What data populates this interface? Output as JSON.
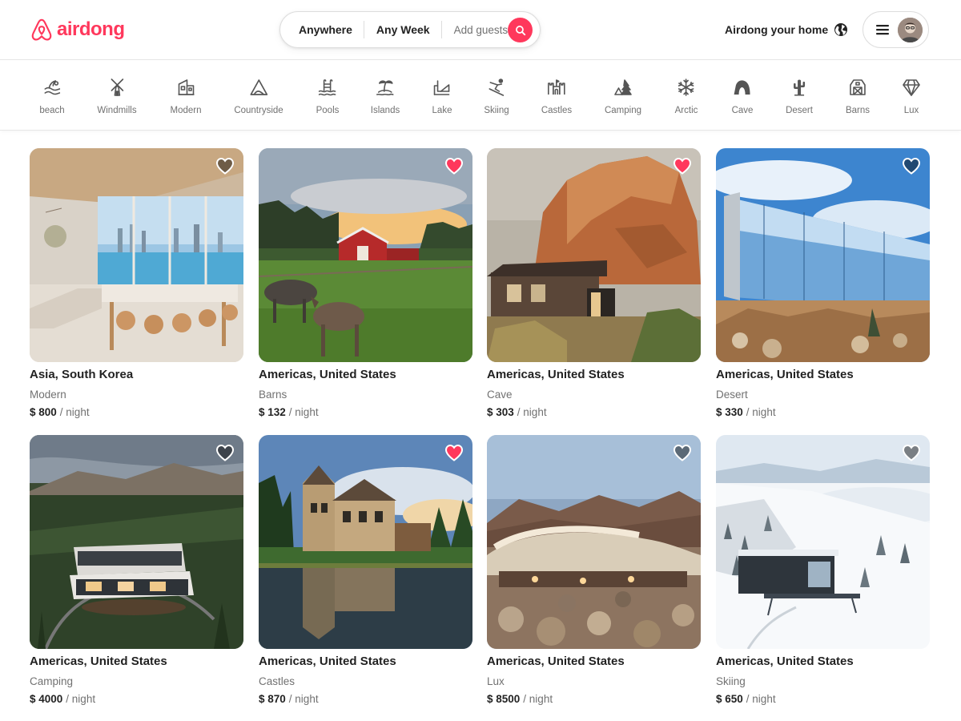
{
  "brand": {
    "name": "airdong",
    "color": "#ff385c"
  },
  "search": {
    "where": "Anywhere",
    "when": "Any Week",
    "who": "Add guests",
    "button_icon": "search-icon"
  },
  "header": {
    "host_link": "Airdong your home",
    "globe_icon": "globe-icon",
    "menu_icon": "hamburger-icon"
  },
  "categories": [
    {
      "label": "beach",
      "icon": "beach-icon"
    },
    {
      "label": "Windmills",
      "icon": "windmill-icon"
    },
    {
      "label": "Modern",
      "icon": "modern-house-icon"
    },
    {
      "label": "Countryside",
      "icon": "countryside-icon"
    },
    {
      "label": "Pools",
      "icon": "pool-icon"
    },
    {
      "label": "Islands",
      "icon": "island-icon"
    },
    {
      "label": "Lake",
      "icon": "lake-icon"
    },
    {
      "label": "Skiing",
      "icon": "skiing-icon"
    },
    {
      "label": "Castles",
      "icon": "castle-icon"
    },
    {
      "label": "Camping",
      "icon": "camping-icon"
    },
    {
      "label": "Arctic",
      "icon": "snowflake-icon"
    },
    {
      "label": "Cave",
      "icon": "cave-icon"
    },
    {
      "label": "Desert",
      "icon": "cactus-icon"
    },
    {
      "label": "Barns",
      "icon": "barn-icon"
    },
    {
      "label": "Lux",
      "icon": "diamond-icon"
    }
  ],
  "listings": [
    {
      "location": "Asia, South Korea",
      "category": "Modern",
      "price": "$ 800",
      "per": "/ night",
      "favorited": false
    },
    {
      "location": "Americas, United States",
      "category": "Barns",
      "price": "$ 132",
      "per": "/ night",
      "favorited": true
    },
    {
      "location": "Americas, United States",
      "category": "Cave",
      "price": "$ 303",
      "per": "/ night",
      "favorited": true
    },
    {
      "location": "Americas, United States",
      "category": "Desert",
      "price": "$ 330",
      "per": "/ night",
      "favorited": false
    },
    {
      "location": "Americas, United States",
      "category": "Camping",
      "price": "$ 4000",
      "per": "/ night",
      "favorited": false
    },
    {
      "location": "Americas, United States",
      "category": "Castles",
      "price": "$ 870",
      "per": "/ night",
      "favorited": true
    },
    {
      "location": "Americas, United States",
      "category": "Lux",
      "price": "$ 8500",
      "per": "/ night",
      "favorited": false
    },
    {
      "location": "Americas, United States",
      "category": "Skiing",
      "price": "$ 650",
      "per": "/ night",
      "favorited": false
    }
  ],
  "colors": {
    "favorite_on": "#ff385c",
    "favorite_off": "rgba(0,0,0,0.5)",
    "muted_text": "#717171"
  }
}
